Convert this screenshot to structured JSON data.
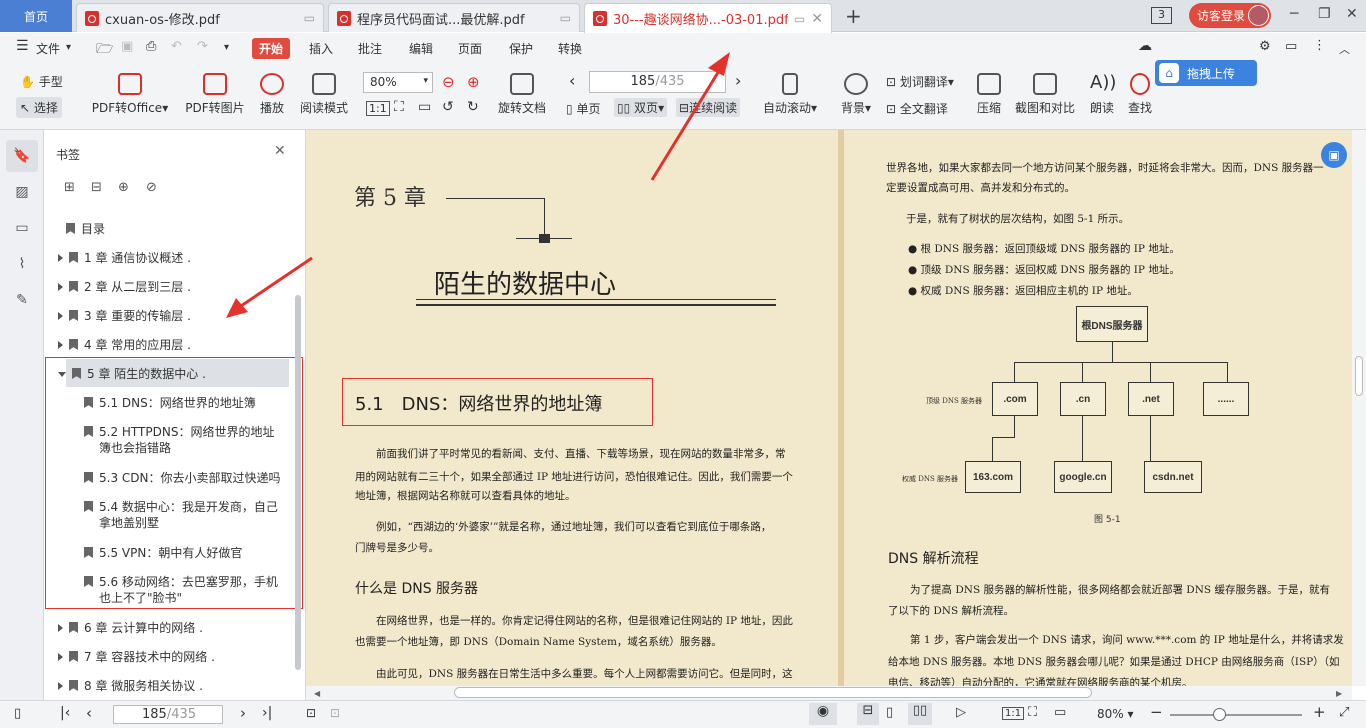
{
  "tabs": {
    "home": "首页",
    "t1": "cxuan-os-修改.pdf",
    "t2": "程序员代码面试...最优解.pdf",
    "t3": "30---趣谈网络协...-03-01.pdf",
    "badge": "3",
    "login": "访客登录"
  },
  "menu": {
    "file": "文件",
    "start": "开始",
    "insert": "插入",
    "annotate": "批注",
    "edit": "编辑",
    "page": "页面",
    "protect": "保护",
    "convert": "转换",
    "drag_upload": "拖拽上传"
  },
  "ribbon": {
    "hand": "手型",
    "select": "选择",
    "pdf2office": "PDF转Office",
    "pdf2img": "PDF转图片",
    "play": "播放",
    "readmode": "阅读模式",
    "zoom": "80%",
    "rotate": "旋转文档",
    "single": "单页",
    "double": "双页",
    "continuous": "连续阅读",
    "page_cur": "185",
    "page_total": "/435",
    "autoscroll": "自动滚动",
    "bg": "背景",
    "wordtrans": "划词翻译",
    "fulltrans": "全文翻译",
    "compress": "压缩",
    "crop": "截图和对比",
    "read": "朗读",
    "search": "查找"
  },
  "bookmarks": {
    "title": "书签",
    "items": [
      "目录",
      "1 章 通信协议概述 .",
      "2 章 从二层到三层 .",
      "3 章 重要的传输层 .",
      "4 章 常用的应用层 .",
      "5 章 陌生的数据中心 .",
      "5.1 DNS：网络世界的地址簿",
      "5.2 HTTPDNS：网络世界的地址",
      "簿也会指错路",
      "5.3 CDN：你去小卖部取过快递吗",
      "5.4 数据中心：我是开发商，自己",
      "拿地盖别墅",
      "5.5 VPN：朝中有人好做官",
      "5.6 移动网络：去巴塞罗那，手机",
      "也上不了\"脸书\"",
      "6 章 云计算中的网络 .",
      "7 章 容器技术中的网络 .",
      "8 章 微服务相关协议 ."
    ]
  },
  "left_page": {
    "chapter": "第 5 章",
    "title": "陌生的数据中心",
    "section": "5.1　DNS：网络世界的地址簿",
    "p1": [
      "前面我们讲了平时常见的看新闻、支付、直播、下载等场景，现在网站的数量非常多，常",
      "用的网站就有二三十个，如果全部通过 IP 地址进行访问，恐怕很难记住。因此，我们需要一个",
      "地址簿，根据网站名称就可以查看具体的地址。"
    ],
    "p2": [
      "例如，“西湖边的‘外婆家’”就是名称，通过地址簿，我们可以查看它到底位于哪条路，",
      "门牌号是多少号。"
    ],
    "h2": "什么是 DNS 服务器",
    "p3": [
      "在网络世界，也是一样的。你肯定记得住网站的名称，但是很难记住网站的 IP 地址，因此",
      "也需要一个地址簿，即 DNS（Domain Name System，域名系统）服务器。"
    ],
    "p4": "由此可见，DNS 服务器在日常生活中多么重要。每个人上网都需要访问它。但是同时，这"
  },
  "right_page": {
    "l1": "世界各地，如果大家都去同一个地方访问某个服务器，时延将会非常大。因而，DNS 服务器一",
    "l2": "定要设置成高可用、高并发和分布式的。",
    "l3": "于是，就有了树状的层次结构，如图 5-1 所示。",
    "bul": [
      "根 DNS 服务器：返回顶级域 DNS 服务器的 IP 地址。",
      "顶级 DNS 服务器：返回权威 DNS 服务器的 IP 地址。",
      "权威 DNS 服务器：返回相应主机的 IP 地址。"
    ],
    "root": "根DNS服务器",
    "tld_label": "顶级 DNS 服务器",
    "auth_label": "权威 DNS 服务器",
    "tld": [
      ".com",
      ".cn",
      ".net",
      "......"
    ],
    "auth": [
      "163.com",
      "google.cn",
      "csdn.net"
    ],
    "caption": "图 5-1",
    "h2": "DNS 解析流程",
    "p1": [
      "为了提高 DNS 服务器的解析性能，很多网络都会就近部署 DNS 缓存服务器。于是，就有",
      "了以下的 DNS 解析流程。"
    ],
    "p2": [
      "第 1 步，客户端会发出一个 DNS 请求，询问 www.***.com 的 IP 地址是什么，并将请求发",
      "给本地 DNS 服务器。本地 DNS 服务器会哪儿呢？如果是通过 DHCP 由网络服务商（ISP）（如",
      "电信、移动等）自动分配的，它通常就在网络服务商的某个机房。"
    ]
  },
  "status": {
    "page_cur": "185",
    "page_total": "/435",
    "zoom": "80%"
  }
}
